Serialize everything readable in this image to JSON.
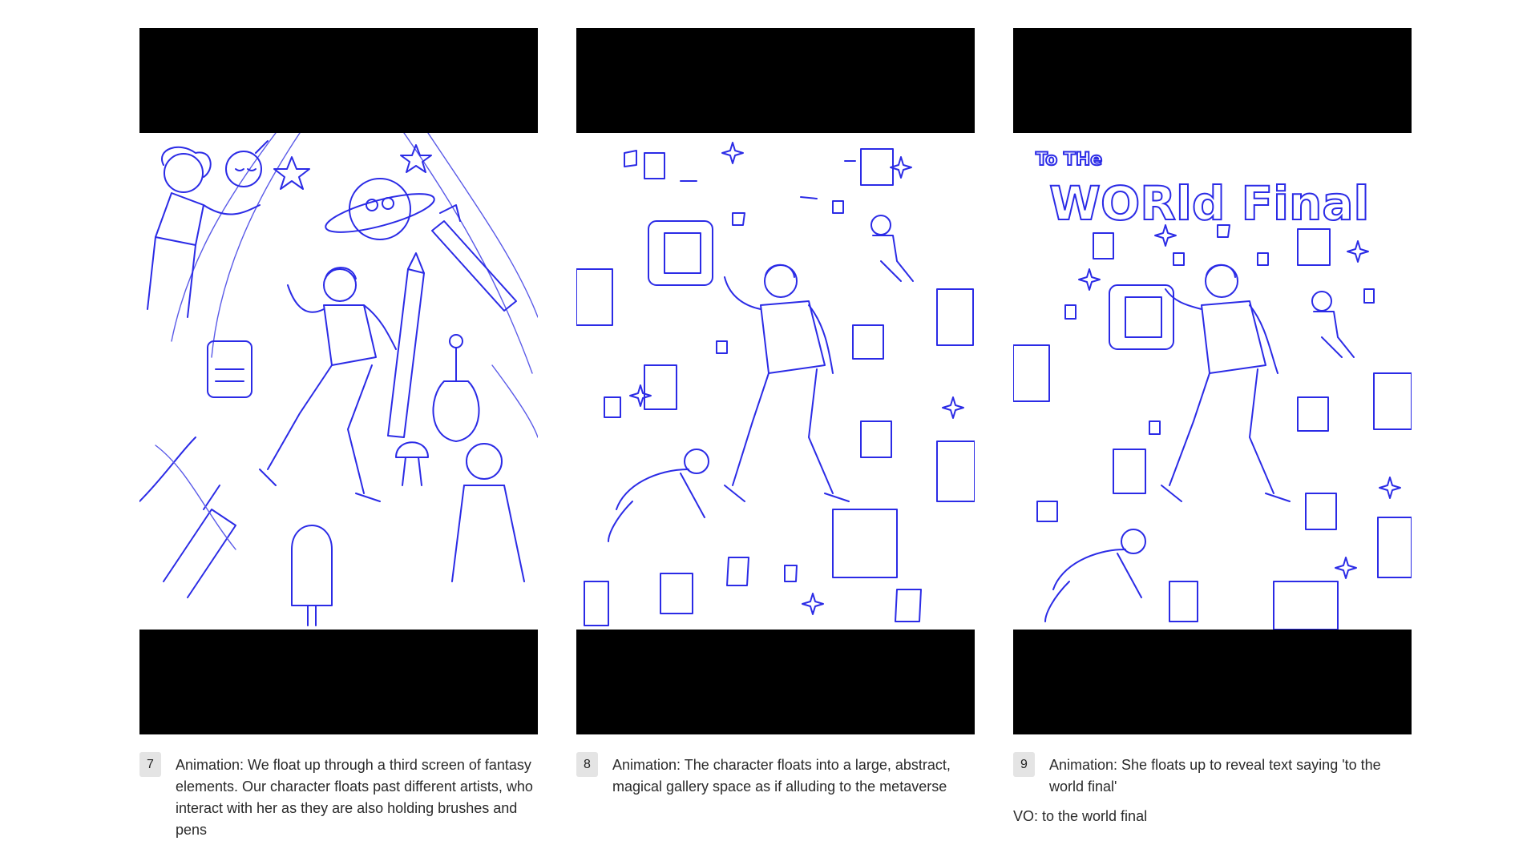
{
  "panels": [
    {
      "number": "7",
      "description": "Animation: We float up through a third screen of fantasy elements. Our character floats past different artists, who interact with her as they are also holding brushes and pens",
      "vo": ""
    },
    {
      "number": "8",
      "description": "Animation: The character floats into a large, abstract, magical gallery space as if alluding to the metaverse",
      "vo": ""
    },
    {
      "number": "9",
      "description": "Animation: She floats up to reveal text saying 'to the world final'",
      "vo": "VO: to the world final"
    }
  ],
  "artwork_text": {
    "line1": "To THe",
    "line2": "WORld Final"
  },
  "colors": {
    "ink": "#2b2be6",
    "letterbox": "#000000",
    "badge": "#e4e4e4"
  }
}
